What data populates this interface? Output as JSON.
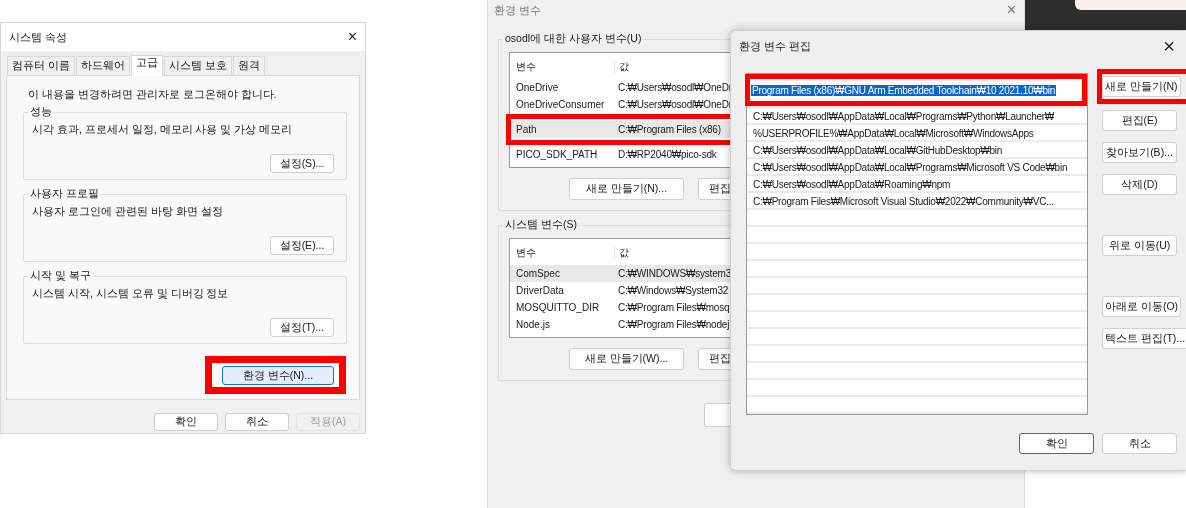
{
  "system_properties": {
    "title": "시스템 속성",
    "close": "×",
    "tabs": [
      {
        "label": "컴퓨터 이름",
        "selected": false
      },
      {
        "label": "하드웨어",
        "selected": false
      },
      {
        "label": "고급",
        "selected": true
      },
      {
        "label": "시스템 보호",
        "selected": false
      },
      {
        "label": "원격",
        "selected": false
      }
    ],
    "notice": "이 내용을 변경하려면 관리자로 로그온해야 합니다.",
    "groups": [
      {
        "title": "성능",
        "description": "시각 효과, 프로세서 일정, 메모리 사용 및 가상 메모리",
        "button": "설정(S)..."
      },
      {
        "title": "사용자 프로필",
        "description": "사용자 로그인에 관련된 바탕 화면 설정",
        "button": "설정(E)..."
      },
      {
        "title": "시작 및 복구",
        "description": "시스템 시작, 시스템 오류 및 디버깅 정보",
        "button": "설정(T)..."
      }
    ],
    "env_button": {
      "label": "환경 변수(N)...",
      "highlighted": true
    },
    "buttons": [
      {
        "label": "확인",
        "disabled": false
      },
      {
        "label": "취소",
        "disabled": false
      },
      {
        "label": "적용(A)",
        "disabled": true
      }
    ]
  },
  "env_vars": {
    "title": "환경 변수",
    "close": "×",
    "sections": [
      {
        "title": "osodl에 대한 사용자 변수(U)",
        "columns": [
          "변수",
          "값"
        ],
        "rows": [
          {
            "name": "OneDrive",
            "value": "C:₩Users₩osodl₩OneDr",
            "selected": false,
            "highlighted": false
          },
          {
            "name": "OneDriveConsumer",
            "value": "C:₩Users₩osodl₩OneDr",
            "selected": false,
            "highlighted": false
          },
          {
            "name": "Path",
            "value": "C:₩Program Files (x86)",
            "selected": true,
            "highlighted": true
          },
          {
            "name": "PICO_SDK_PATH",
            "value": "D:₩RP2040₩pico-sdk",
            "selected": false,
            "highlighted": false
          }
        ],
        "buttons": [
          "새로 만들기(N)...",
          "편집"
        ]
      },
      {
        "title": "시스템 변수(S)",
        "columns": [
          "변수",
          "값"
        ],
        "rows": [
          {
            "name": "ComSpec",
            "value": "C:₩WINDOWS₩system3",
            "selected": true,
            "highlighted": false
          },
          {
            "name": "DriverData",
            "value": "C:₩Windows₩System32",
            "selected": false,
            "highlighted": false
          },
          {
            "name": "MOSQUITTO_DIR",
            "value": "C:₩Program Files₩mosq",
            "selected": false,
            "highlighted": false
          },
          {
            "name": "Node.js",
            "value": "C:₩Program Files₩nodej",
            "selected": false,
            "highlighted": false
          }
        ],
        "buttons": [
          "새로 만들기(W)...",
          "편집"
        ]
      }
    ]
  },
  "edit_dialog": {
    "title": "환경 변수 편집",
    "close": "×",
    "items": [
      {
        "text": "Program Files (x86)₩GNU Arm Embedded Toolchain₩10 2021.10₩bin",
        "selected": true,
        "highlighted": true
      },
      {
        "text": "C:₩Users₩osodl₩AppData₩Local₩Programs₩Python₩Launcher₩",
        "selected": false,
        "highlighted": false
      },
      {
        "text": "%USERPROFILE%₩AppData₩Local₩Microsoft₩WindowsApps",
        "selected": false,
        "highlighted": false
      },
      {
        "text": "C:₩Users₩osodl₩AppData₩Local₩GitHubDesktop₩bin",
        "selected": false,
        "highlighted": false
      },
      {
        "text": "C:₩Users₩osodl₩AppData₩Local₩Programs₩Microsoft VS Code₩bin",
        "selected": false,
        "highlighted": false
      },
      {
        "text": "C:₩Users₩osodl₩AppData₩Roaming₩npm",
        "selected": false,
        "highlighted": false
      },
      {
        "text": "C:₩Program Files₩Microsoft Visual Studio₩2022₩Community₩VC...",
        "selected": false,
        "highlighted": false
      }
    ],
    "buttons": [
      {
        "label": "새로 만들기(N)",
        "highlighted": true
      },
      {
        "label": "편집(E)",
        "highlighted": false
      },
      {
        "label": "찾아보기(B)...",
        "highlighted": false
      },
      {
        "label": "삭제(D)",
        "highlighted": false
      },
      {
        "label": "위로 이동(U)",
        "highlighted": false
      },
      {
        "label": "아래로 이동(O)",
        "highlighted": false
      },
      {
        "label": "텍스트 편집(T)...",
        "highlighted": false
      }
    ],
    "footer_buttons": [
      {
        "label": "확인",
        "default": true
      },
      {
        "label": "취소",
        "default": false
      }
    ]
  }
}
